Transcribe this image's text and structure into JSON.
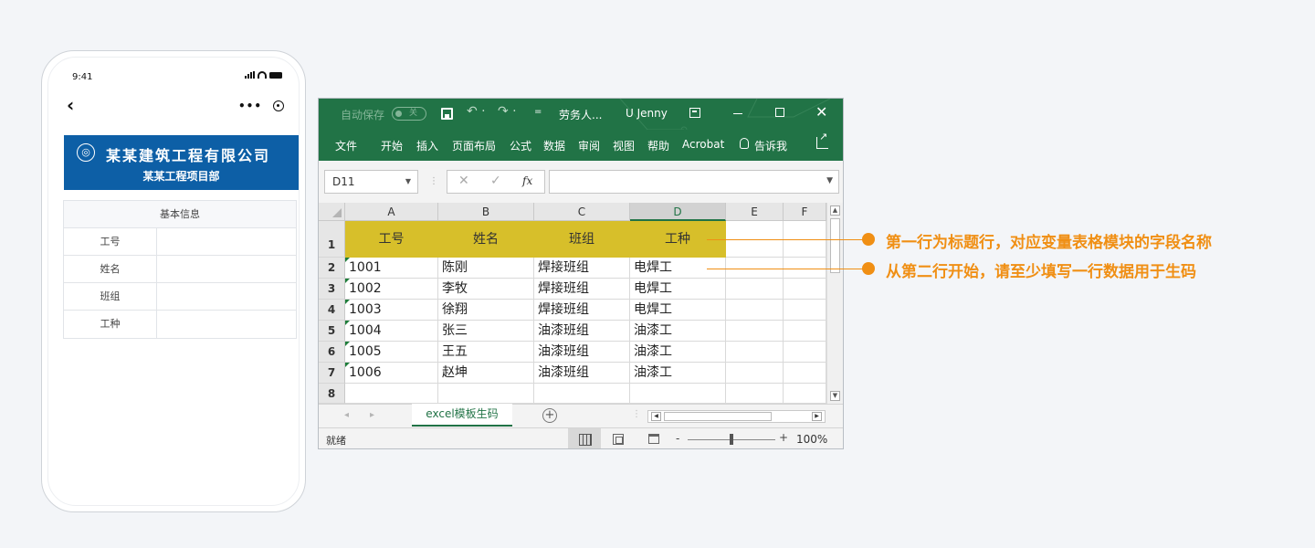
{
  "phone": {
    "time": "9:41",
    "back": "‹",
    "capsule_more": "•••",
    "company": {
      "logo_icon": "company-logo-icon",
      "name": "某某建筑工程有限公司",
      "department": "某某工程项目部"
    },
    "info_table": {
      "header": "基本信息",
      "rows": [
        {
          "label": "工号"
        },
        {
          "label": "姓名"
        },
        {
          "label": "班组"
        },
        {
          "label": "工种"
        }
      ]
    }
  },
  "excel": {
    "title_bar": {
      "autosave_label": "自动保存",
      "autosave_state": "关",
      "more": "=",
      "doc_title": "劳务人...",
      "user": "U Jenny",
      "close": "✕",
      "undo": "↶ ·",
      "redo": "↷ ·"
    },
    "ribbon_tabs": [
      "文件",
      "开始",
      "插入",
      "页面布局",
      "公式",
      "数据",
      "审阅",
      "视图",
      "帮助",
      "Acrobat",
      "告诉我"
    ],
    "name_box": "D11",
    "fx_cancel": "✕",
    "fx_enter": "✓",
    "fx_label": "fx",
    "columns": [
      "A",
      "B",
      "C",
      "D",
      "E",
      "F"
    ],
    "active_column": "D",
    "rows": [
      "1",
      "2",
      "3",
      "4",
      "5",
      "6",
      "7",
      "8"
    ],
    "header_row": [
      "工号",
      "姓名",
      "班组",
      "工种"
    ],
    "data_rows": [
      [
        "1001",
        "陈刚",
        "焊接班组",
        "电焊工"
      ],
      [
        "1002",
        "李牧",
        "焊接班组",
        "电焊工"
      ],
      [
        "1003",
        "徐翔",
        "焊接班组",
        "电焊工"
      ],
      [
        "1004",
        "张三",
        "油漆班组",
        "油漆工"
      ],
      [
        "1005",
        "王五",
        "油漆班组",
        "油漆工"
      ],
      [
        "1006",
        "赵坤",
        "油漆班组",
        "油漆工"
      ]
    ],
    "sheet_tab": "excel模板生码",
    "sheet_nav_prev": "◂",
    "sheet_nav_next": "▸",
    "add_sheet": "+",
    "status": "就绪",
    "zoom_minus": "-",
    "zoom_plus": "+",
    "zoom": "100%",
    "zoom_fraction": 0.48,
    "accent_color": "#217346",
    "header_fill_color": "#d7bf2a"
  },
  "annotations": [
    {
      "text": "第一行为标题行，对应变量表格模块的字段名称"
    },
    {
      "text": "从第二行开始，请至少填写一行数据用于生码"
    }
  ],
  "annotation_color": "#f08f14"
}
